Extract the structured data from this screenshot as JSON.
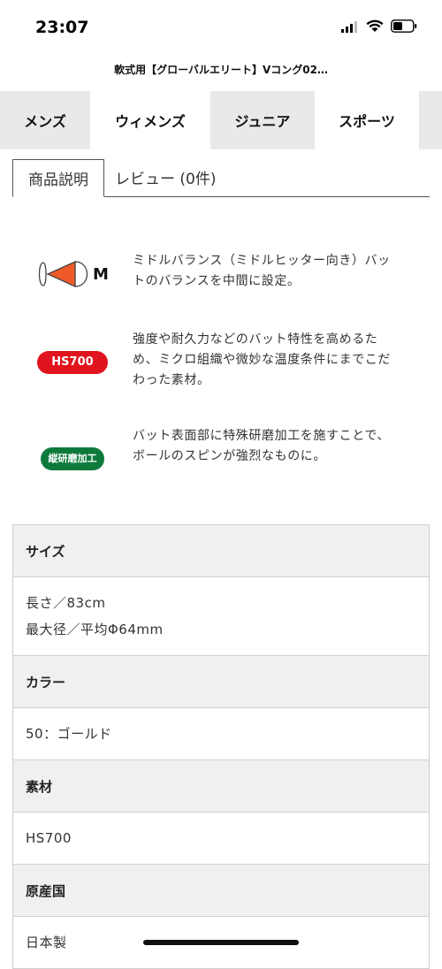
{
  "status": {
    "time": "23:07"
  },
  "page_title": "軟式用【グローバルエリート】Vコング02…",
  "categories": [
    {
      "label": "メンズ"
    },
    {
      "label": "ウィメンズ"
    },
    {
      "label": "ジュニア"
    },
    {
      "label": "スポーツ"
    }
  ],
  "detail_tabs": {
    "description": "商品説明",
    "review": "レビュー (0件)"
  },
  "features": [
    {
      "icon_label": "M",
      "icon": "middle-balance-icon",
      "text": "ミドルバランス（ミドルヒッター向き）バットのバランスを中間に設定。"
    },
    {
      "icon_label": "HS700",
      "icon": "hs700-badge",
      "text": "強度や耐久力などのバット特性を高めるため、ミクロ組織や微妙な温度条件にまでこだわった素材。"
    },
    {
      "icon_label": "縦研磨加工",
      "icon": "vertical-grinding-badge",
      "text": "バット表面部に特殊研磨加工を施すことで、ボールのスピンが強烈なものに。"
    }
  ],
  "specs": [
    {
      "label": "サイズ",
      "lines": [
        "長さ／83cm",
        "最大径／平均Φ64mm"
      ]
    },
    {
      "label": "カラー",
      "lines": [
        "50：ゴールド"
      ]
    },
    {
      "label": "素材",
      "lines": [
        "HS700"
      ]
    },
    {
      "label": "原産国",
      "lines": [
        "日本製"
      ]
    }
  ],
  "colors": {
    "hs_badge": "#e0141e",
    "grind_badge": "#0d7a3c",
    "balance_accent": "#f05a28"
  }
}
